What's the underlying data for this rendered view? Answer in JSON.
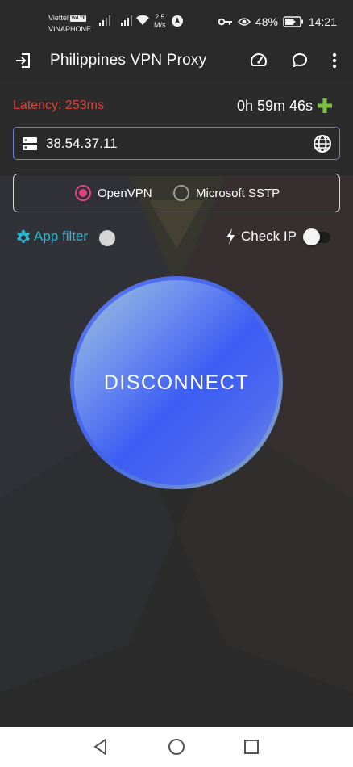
{
  "status_bar": {
    "carrier_1": "Viettel",
    "volte_badge": "VoLTE",
    "carrier_2": "VINAPHONE",
    "net_speed_value": "2.5",
    "net_speed_unit": "M/s",
    "battery_percent": "48%",
    "time": "14:21",
    "icons": [
      "signal-icon",
      "wifi-icon",
      "location-icon",
      "key-icon",
      "eye-icon",
      "battery-icon"
    ]
  },
  "app_bar": {
    "title": "Philippines VPN Proxy",
    "icons": [
      "exit-icon",
      "speedometer-icon",
      "chat-icon",
      "more-icon"
    ]
  },
  "main": {
    "latency": "Latency: 253ms",
    "timer": "0h 59m 46s",
    "ip_value": "38.54.37.11",
    "protocols": [
      {
        "label": "OpenVPN",
        "selected": true
      },
      {
        "label": "Microsoft SSTP",
        "selected": false
      }
    ],
    "app_filter_label": "App filter",
    "check_ip_label": "Check IP",
    "app_filter_enabled": false,
    "check_ip_enabled": false,
    "disconnect_label": "DISCONNECT"
  },
  "colors": {
    "latency": "#d9423c",
    "plus": "#7cc142",
    "radio_selected": "#e0457c",
    "app_filter": "#2cb6d4",
    "button_blue": "#3c5df2"
  },
  "nav_bar": {
    "icons": [
      "back-icon",
      "home-icon",
      "recents-icon"
    ]
  }
}
